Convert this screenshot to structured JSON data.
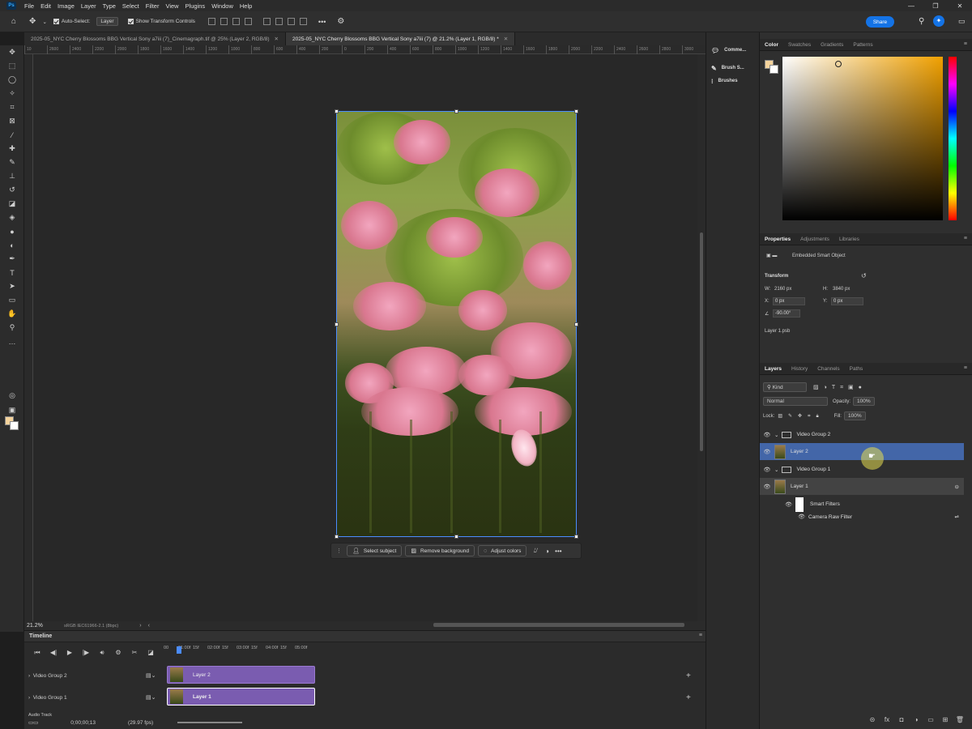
{
  "menubar": {
    "logo": "Ps",
    "items": [
      "File",
      "Edit",
      "Image",
      "Layer",
      "Type",
      "Select",
      "Filter",
      "View",
      "Plugins",
      "Window",
      "Help"
    ],
    "window_controls": [
      "—",
      "❐",
      "✕"
    ]
  },
  "options": {
    "auto_select_label": "Auto-Select:",
    "auto_select_value": "Layer",
    "transform_controls_label": "Show Transform Controls",
    "share_label": "Share"
  },
  "tabs": [
    {
      "label": "2025-05_NYC Cherry Blossoms BBG Vertical Sony a7iii (7)_Cinemagraph.tif @ 25% (Layer 2, RGB/8)",
      "active": false
    },
    {
      "label": "2025-05_NYC Cherry Blossoms BBG Vertical Sony a7iii (7) @ 21.2% (Layer 1, RGB/8) *",
      "active": true
    }
  ],
  "ruler_ticks": [
    "10",
    "2600",
    "2400",
    "2200",
    "2000",
    "1800",
    "1600",
    "1400",
    "1200",
    "1000",
    "800",
    "600",
    "400",
    "200",
    "0",
    "200",
    "400",
    "600",
    "800",
    "1000",
    "1200",
    "1400",
    "1600",
    "1800",
    "2000",
    "2200",
    "2400",
    "2600",
    "2800",
    "3000"
  ],
  "context_bar": {
    "select_subject": "Select subject",
    "remove_background": "Remove background",
    "adjust_colors": "Adjust colors"
  },
  "status": {
    "zoom": "21.2%",
    "profile": "sRGB IEC61966-2.1 (8bpc)"
  },
  "timeline": {
    "title": "Timeline",
    "ruler": [
      "00",
      "01:00f",
      "15f",
      "02:00f",
      "15f",
      "03:00f",
      "15f",
      "04:00f",
      "15f",
      "05:00f"
    ],
    "tracks": [
      {
        "group": "Video Group 2",
        "clip": "Layer 2"
      },
      {
        "group": "Video Group 1",
        "clip": "Layer 1"
      }
    ],
    "audio_label": "Audio Track",
    "timecode": "0;00;00;13",
    "fps": "(29.97 fps)"
  },
  "right_strip": {
    "comments": "Comme...",
    "brush_settings": "Brush S...",
    "brushes": "Brushes"
  },
  "color_panel": {
    "tabs": [
      "Color",
      "Swatches",
      "Gradients",
      "Patterns"
    ],
    "fg_color": "#f4d39c",
    "bg_color": "#ffffff"
  },
  "properties": {
    "tabs": [
      "Properties",
      "Adjustments",
      "Libraries"
    ],
    "type": "Embedded Smart Object",
    "section": "Transform",
    "w_label": "W:",
    "w_value": "2160 px",
    "h_label": "H:",
    "h_value": "3840 px",
    "x_label": "X:",
    "x_value": "0 px",
    "y_label": "Y:",
    "y_value": "0 px",
    "angle_value": "-90.00°",
    "file_name": "Layer 1.psb"
  },
  "layers": {
    "tabs": [
      "Layers",
      "History",
      "Channels",
      "Paths"
    ],
    "filter_kind": "Kind",
    "blend_mode": "Normal",
    "opacity_label": "Opacity:",
    "opacity_value": "100%",
    "lock_label": "Lock:",
    "fill_label": "Fill:",
    "fill_value": "100%",
    "rows": [
      {
        "name": "Video Group 2",
        "kind": "group"
      },
      {
        "name": "Layer 2",
        "kind": "layer",
        "selected": true
      },
      {
        "name": "Video Group 1",
        "kind": "group"
      },
      {
        "name": "Layer 1",
        "kind": "layer"
      },
      {
        "name": "Smart Filters",
        "kind": "smart-filters"
      },
      {
        "name": "Camera Raw Filter",
        "kind": "filter"
      }
    ]
  },
  "accent_colors": {
    "selection": "#4366a8",
    "clip": "#7a5cb0",
    "share": "#1473e6",
    "bbox": "#4b8cff"
  }
}
